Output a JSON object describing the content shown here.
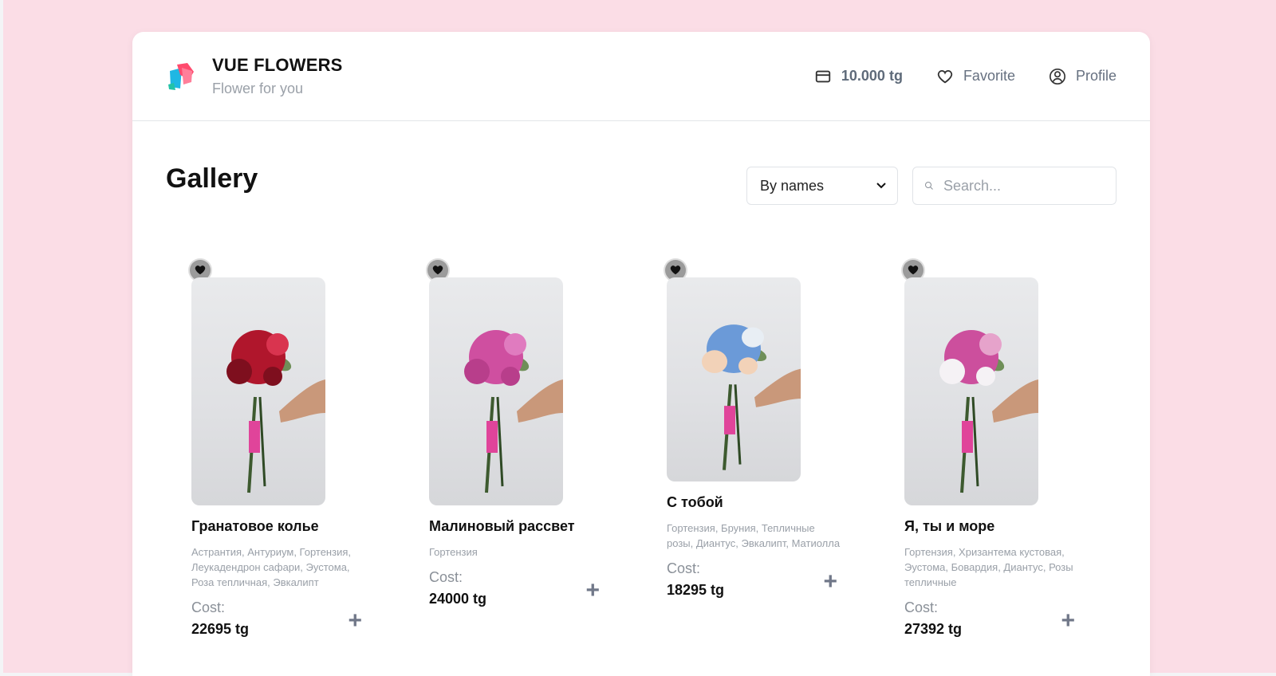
{
  "brand": {
    "title": "VUE FLOWERS",
    "subtitle": "Flower for you"
  },
  "nav": {
    "balance": "10.000 tg",
    "favorite": "Favorite",
    "profile": "Profile"
  },
  "gallery": {
    "title": "Gallery",
    "sort_selected": "By names",
    "search_placeholder": "Search..."
  },
  "cost_label": "Cost:",
  "products": [
    {
      "name": "Гранатовое колье",
      "composition": "Астрантия, Антуриум, Гортензия, Леукадендрон сафари, Эустома, Роза тепличная, Эвкалипт",
      "price": "22695 tg",
      "flower_colors": [
        "#b0162c",
        "#7e0f1e",
        "#d9344f"
      ]
    },
    {
      "name": "Малиновый рассвет",
      "composition": "Гортензия",
      "price": "24000 tg",
      "flower_colors": [
        "#cf4fa0",
        "#b83e8b",
        "#e07bbf"
      ]
    },
    {
      "name": "С тобой",
      "composition": "Гортензия, Бруния, Тепличные розы, Диантус, Эвкалипт, Матиолла",
      "price": "18295 tg",
      "flower_colors": [
        "#6b9ad8",
        "#f2d2b8",
        "#e8eef4"
      ]
    },
    {
      "name": "Я, ты и море",
      "composition": "Гортензия, Хризантема кустовая, Эустома, Бовардия, Диантус, Розы тепличные",
      "price": "27392 tg",
      "flower_colors": [
        "#cc4f9d",
        "#f5f2f5",
        "#e6a3cb"
      ]
    }
  ],
  "colors": {
    "background": "#fbdde6",
    "accent_gray": "#717889"
  }
}
